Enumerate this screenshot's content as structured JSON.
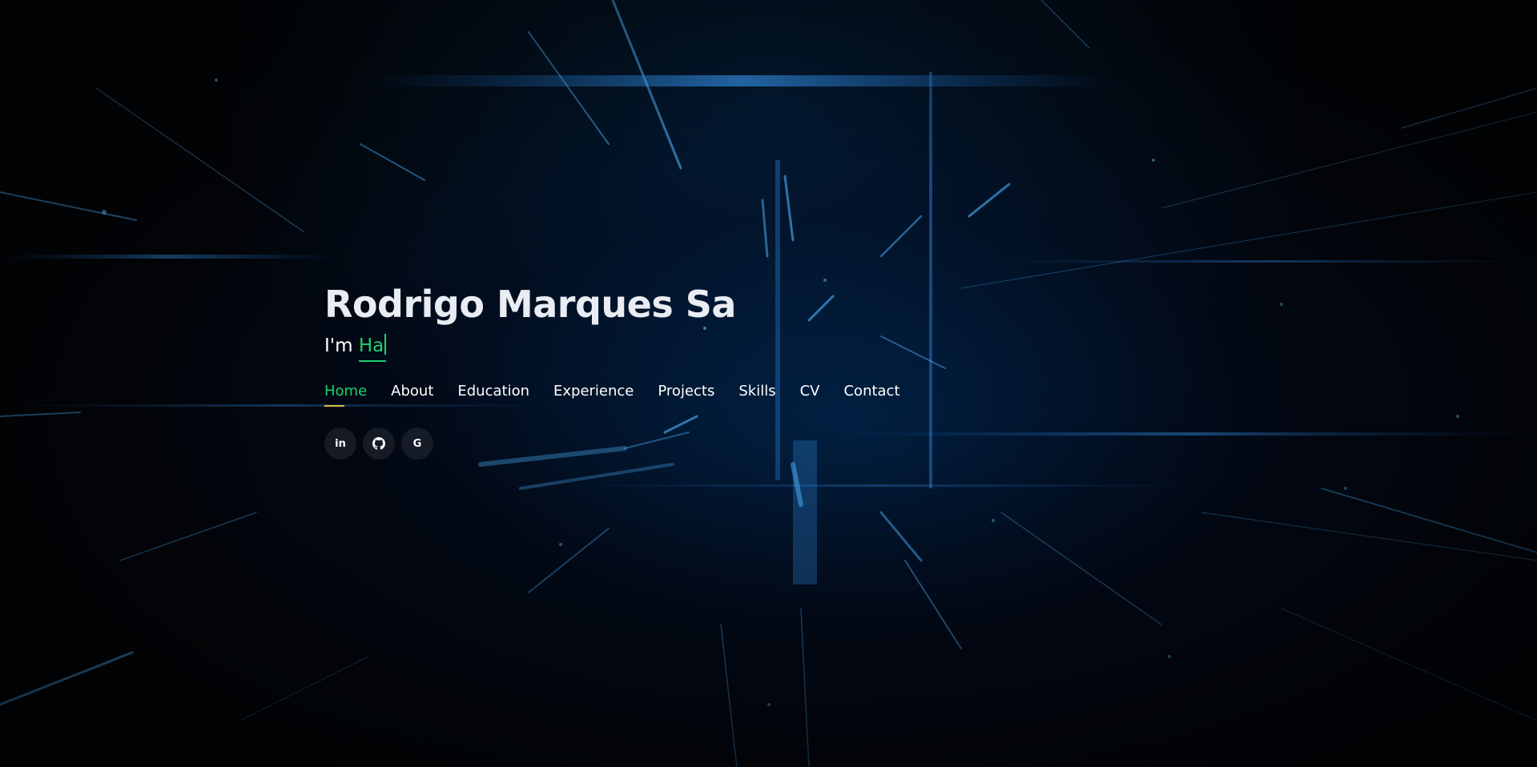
{
  "hero": {
    "name": "Rodrigo Marques Sa",
    "intro_prefix": "I'm ",
    "typed_text": "Ha"
  },
  "nav": {
    "items": [
      {
        "label": "Home",
        "active": true
      },
      {
        "label": "About",
        "active": false
      },
      {
        "label": "Education",
        "active": false
      },
      {
        "label": "Experience",
        "active": false
      },
      {
        "label": "Projects",
        "active": false
      },
      {
        "label": "Skills",
        "active": false
      },
      {
        "label": "CV",
        "active": false
      },
      {
        "label": "Contact",
        "active": false
      }
    ]
  },
  "social": {
    "links": [
      {
        "icon": "linkedin-icon",
        "glyph": "in"
      },
      {
        "icon": "github-icon"
      },
      {
        "icon": "google-icon",
        "glyph": "G"
      }
    ]
  },
  "colors": {
    "accent": "#18d26e",
    "nav_underline": "#e1b54a",
    "title": "#e9ecf2",
    "background": "#020407"
  }
}
